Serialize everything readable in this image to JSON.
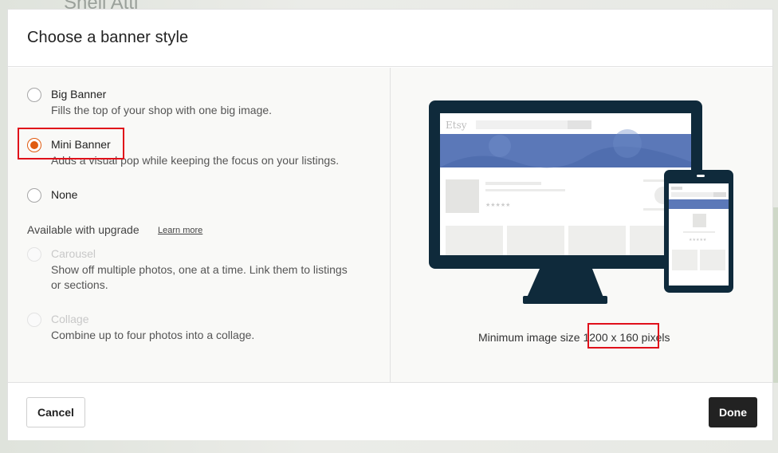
{
  "backdrop": {
    "peek_text": "Snell Atti"
  },
  "modal": {
    "title": "Choose a banner style",
    "options": [
      {
        "label": "Big Banner",
        "description": "Fills the top of your shop with one big image.",
        "selected": false,
        "disabled": false
      },
      {
        "label": "Mini Banner",
        "description": "Adds a visual pop while keeping the focus on your listings.",
        "selected": true,
        "disabled": false
      },
      {
        "label": "None",
        "description": "",
        "selected": false,
        "disabled": false
      }
    ],
    "upgrade": {
      "heading": "Available with upgrade",
      "learn_more": "Learn more",
      "options": [
        {
          "label": "Carousel",
          "description": "Show off multiple photos, one at a time. Link them to listings or sections.",
          "disabled": true
        },
        {
          "label": "Collage",
          "description": "Combine up to four photos into a collage.",
          "disabled": true
        }
      ]
    },
    "preview": {
      "brand": "Etsy",
      "min_size_prefix": "Minimum image size",
      "min_size_value": "1200 x 160",
      "min_size_suffix": "pixels"
    },
    "footer": {
      "cancel_label": "Cancel",
      "done_label": "Done"
    }
  },
  "colors": {
    "accent": "#e05b10",
    "highlight": "#e0101a",
    "monitor": "#0f2a3b",
    "banner_blue": "#5b78b8",
    "primary_button": "#222222"
  }
}
